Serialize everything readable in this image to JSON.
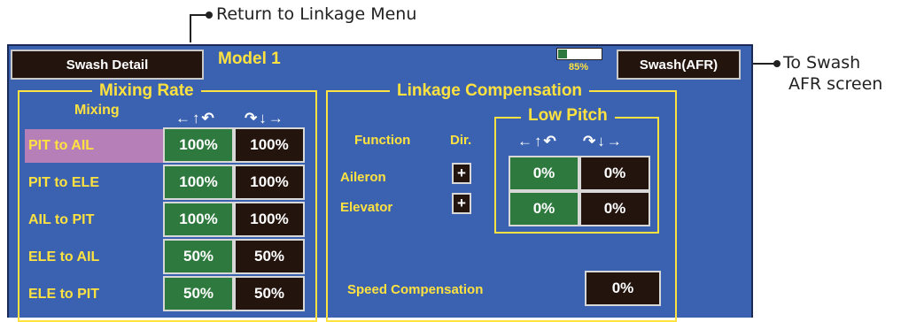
{
  "annotations": {
    "return_link": "Return to Linkage Menu",
    "to_swash_line1": "To Swash",
    "to_swash_line2": "AFR screen"
  },
  "header": {
    "back_button_label": "Swash  Detail",
    "model_name": "Model 1",
    "battery_percent": "85%",
    "swash_button_label": "Swash(AFR)"
  },
  "mixing_rate": {
    "title": "Mixing  Rate",
    "col_header": "Mixing",
    "left_arrows": "←↑↶",
    "right_arrows": "↷↓→",
    "rows": [
      {
        "label": "PIT  to  AIL",
        "left": "100%",
        "right": "100%",
        "selected": true
      },
      {
        "label": "PIT  to  ELE",
        "left": "100%",
        "right": "100%"
      },
      {
        "label": "AIL  to  PIT",
        "left": "100%",
        "right": "100%"
      },
      {
        "label": "ELE  to  AIL",
        "left": "50%",
        "right": "50%"
      },
      {
        "label": "ELE  to  PIT",
        "left": "50%",
        "right": "50%"
      }
    ]
  },
  "linkage_compensation": {
    "title": "Linkage  Compensation",
    "function_header": "Function",
    "dir_header": "Dir.",
    "low_pitch_title": "Low  Pitch",
    "left_arrows": "←↑↶",
    "right_arrows": "↷↓→",
    "rows": [
      {
        "label": "Aileron",
        "dir": "+",
        "left": "0%",
        "right": "0%"
      },
      {
        "label": "Elevator",
        "dir": "+",
        "left": "0%",
        "right": "0%"
      }
    ],
    "speed_label": "Speed  Compensation",
    "speed_value": "0%"
  },
  "colors": {
    "screen_bg": "#3a62b0",
    "accent_yellow": "#ffe240",
    "button_dark": "#24140e",
    "button_green": "#2e7a3e",
    "selected_row": "#b67fb8"
  }
}
